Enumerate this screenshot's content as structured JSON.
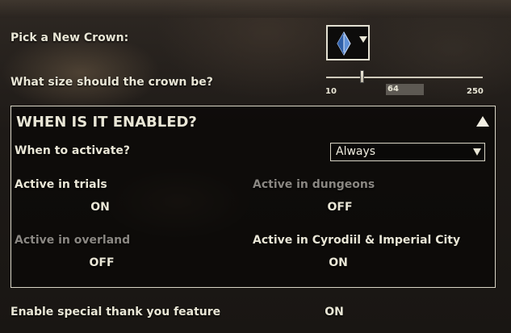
{
  "crown": {
    "label": "Pick a New Crown:",
    "icon": "blue-crystal-crown-icon",
    "icon_color": "#7aa7e0"
  },
  "size": {
    "label": "What size should the crown be?",
    "min": "10",
    "max": "250",
    "value": "64",
    "fraction": 0.225
  },
  "panel": {
    "title": "WHEN IS IT ENABLED?",
    "activate_label": "When to activate?",
    "activate_value": "Always",
    "trials_label": "Active in trials",
    "trials_value": "ON",
    "dungeons_label": "Active in dungeons",
    "dungeons_value": "OFF",
    "overland_label": "Active in overland",
    "overland_value": "OFF",
    "cyrodiil_label": "Active in Cyrodiil & Imperial City",
    "cyrodiil_value": "ON"
  },
  "thanks": {
    "label": "Enable special thank you feature",
    "value": "ON"
  },
  "colors": {
    "text": "#e9e6d6",
    "dim_text": "#8a8782",
    "border": "#d9d5c6"
  }
}
